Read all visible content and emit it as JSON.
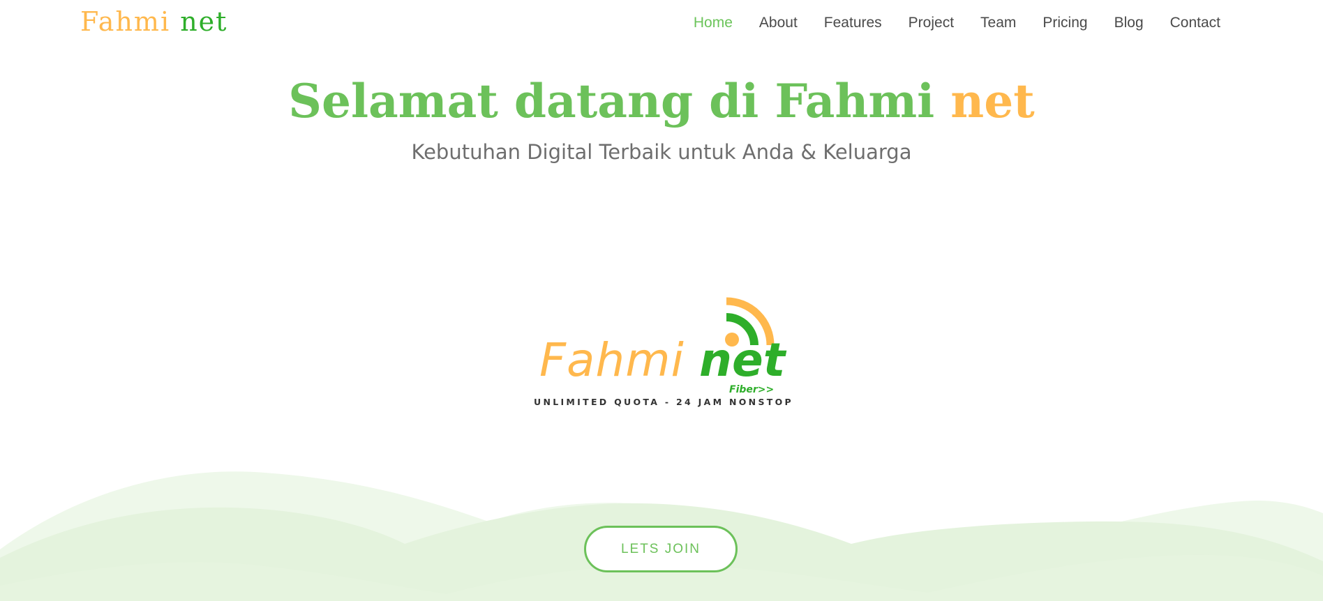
{
  "header": {
    "brand": {
      "part1": "Fahmi",
      "part2": "net"
    },
    "nav": [
      {
        "label": "Home",
        "active": true
      },
      {
        "label": "About",
        "active": false
      },
      {
        "label": "Features",
        "active": false
      },
      {
        "label": "Project",
        "active": false
      },
      {
        "label": "Team",
        "active": false
      },
      {
        "label": "Pricing",
        "active": false
      },
      {
        "label": "Blog",
        "active": false
      },
      {
        "label": "Contact",
        "active": false
      }
    ]
  },
  "hero": {
    "title_main": "Selamat datang di Fahmi",
    "title_accent": "net",
    "subtitle": "Kebutuhan Digital Terbaik untuk Anda & Keluarga",
    "cta_label": "LETS JOIN"
  },
  "logo": {
    "word1": "Fahmi",
    "word2": "net",
    "fiber": "Fiber>>",
    "tagline": "UNLIMITED QUOTA - 24 JAM NONSTOP",
    "icon": "wifi-signal-icon"
  },
  "colors": {
    "green": "#6cc15a",
    "dark_green": "#2eae2a",
    "orange": "#ffb84d",
    "text_gray": "#4a4a4a",
    "wave_light": "#eaf6e6",
    "wave_mid": "#dff1d8"
  }
}
